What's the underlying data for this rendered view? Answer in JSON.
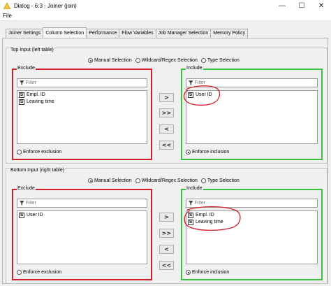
{
  "window": {
    "title": "Dialog - 6:3 - Joiner (join)",
    "minimize": "—",
    "maximize": "☐",
    "close": "✕"
  },
  "menu": {
    "file": "File"
  },
  "tabs": [
    {
      "label": "Joiner Settings"
    },
    {
      "label": "Column Selection"
    },
    {
      "label": "Performance"
    },
    {
      "label": "Flow Variables"
    },
    {
      "label": "Job Manager Selection"
    },
    {
      "label": "Memory Policy"
    }
  ],
  "active_tab": "Column Selection",
  "top": {
    "title": "Top Input (left table)",
    "modes": [
      "Manual Selection",
      "Wildcard/Regex Selection",
      "Type Selection"
    ],
    "exclude_title": "Exclude",
    "include_title": "Include",
    "filter_placeholder": "Filter",
    "exclude_items": [
      {
        "type": "S",
        "name": "Empl. ID"
      },
      {
        "type": "S",
        "name": "Leaving time"
      }
    ],
    "include_items": [
      {
        "type": "S",
        "name": "User ID"
      }
    ],
    "enforce_exclusion": "Enforce exclusion",
    "enforce_inclusion": "Enforce inclusion"
  },
  "bottom": {
    "title": "Bottom Input (right table)",
    "modes": [
      "Manual Selection",
      "Wildcard/Regex Selection",
      "Type Selection"
    ],
    "exclude_title": "Exclude",
    "include_title": "Include",
    "filter_placeholder": "Filter",
    "exclude_items": [
      {
        "type": "S",
        "name": "User ID"
      }
    ],
    "include_items": [
      {
        "type": "S",
        "name": "Empl. ID"
      },
      {
        "type": "S",
        "name": "Leaving time"
      }
    ],
    "enforce_exclusion": "Enforce exclusion",
    "enforce_inclusion": "Enforce inclusion"
  },
  "buttons": {
    "add": ">",
    "add_all": ">>",
    "remove": "<",
    "remove_all": "<<"
  },
  "colors": {
    "annotation_red": "#d21d2a",
    "annotation_green": "#39c13d"
  }
}
